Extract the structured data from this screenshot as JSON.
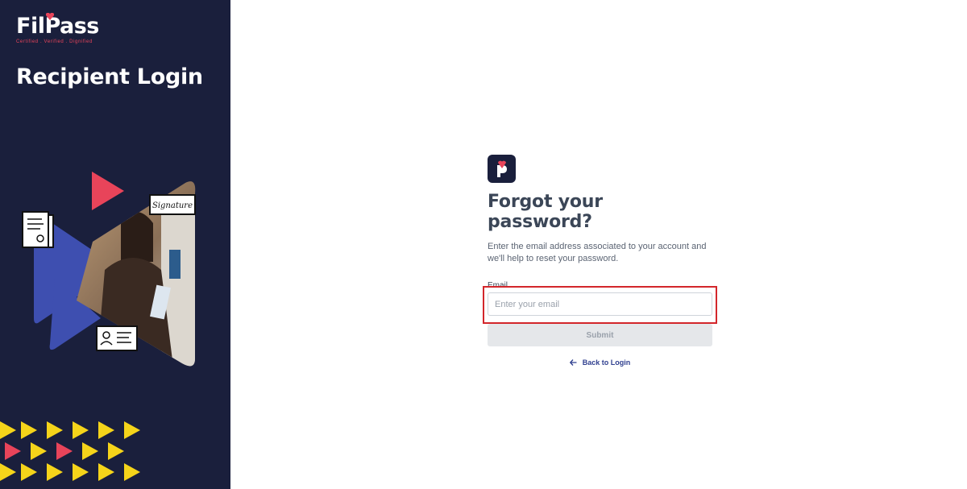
{
  "brand": {
    "logo_text": "FilPass",
    "tagline": "Certified . Verified . Dignified",
    "colors": {
      "navy": "#1a1f3c",
      "accent_red": "#e8445a",
      "yellow": "#f5d41a",
      "blue": "#3e4fb0"
    }
  },
  "left_panel": {
    "title": "Recipient Login",
    "hero_image": {
      "description_icons": [
        "document-icon",
        "signature-icon",
        "id-card-icon"
      ],
      "signature_text": "Signature"
    }
  },
  "form": {
    "title": "Forgot your password?",
    "description": "Enter the email address associated to your account and we'll help to reset your password.",
    "email_label": "Email",
    "email_placeholder": "Enter your email",
    "email_value": "",
    "submit_label": "Submit",
    "back_label": "Back to Login"
  },
  "annotation": {
    "highlight_color": "#d3262b"
  }
}
